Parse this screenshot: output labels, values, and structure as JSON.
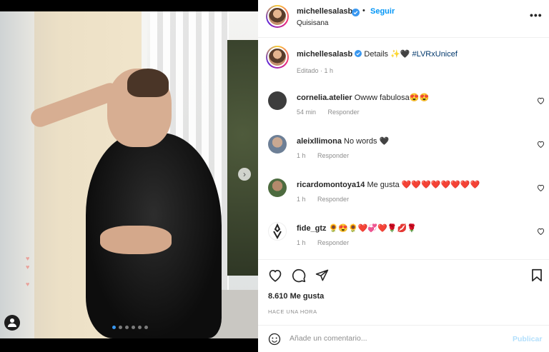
{
  "colors": {
    "accent": "#0095f6",
    "verified": "#3897f0",
    "text": "#262626",
    "muted": "#8e8e8e",
    "like_red": "#ed4956"
  },
  "post": {
    "carousel": {
      "count": 6,
      "active_index": 0
    },
    "tag_icon": "user-tag-icon",
    "next_icon": "chevron-right-icon"
  },
  "header": {
    "username": "michellesalasb",
    "separator": "•",
    "follow_label": "Seguir",
    "location": "Quisisana",
    "more_icon": "more-options-icon",
    "more_label": "•••"
  },
  "caption": {
    "username": "michellesalasb",
    "text": "Details ✨🖤",
    "hashtag": "#LVRxUnicef",
    "meta": "Editado · 1 h"
  },
  "comments": [
    {
      "user": "cornelia.atelier",
      "text": "Owww fabulosa😍😍",
      "time": "54 min",
      "reply": "Responder"
    },
    {
      "user": "aleixllimona",
      "text": "No words 🖤",
      "time": "1 h",
      "reply": "Responder"
    },
    {
      "user": "ricardomontoya14",
      "text": "Me gusta ❤️❤️❤️❤️❤️❤️❤️❤️",
      "time": "1 h",
      "reply": "Responder"
    },
    {
      "user": "fide_gtz",
      "text": "🌻😍🌻❤️💞❤️🌹💋🌹",
      "time": "1 h",
      "reply": "Responder"
    }
  ],
  "actions": {
    "likes": "8.610 Me gusta",
    "time_ago": "HACE UNA HORA"
  },
  "comment_box": {
    "placeholder": "Añade un comentario...",
    "post_label": "Publicar"
  }
}
